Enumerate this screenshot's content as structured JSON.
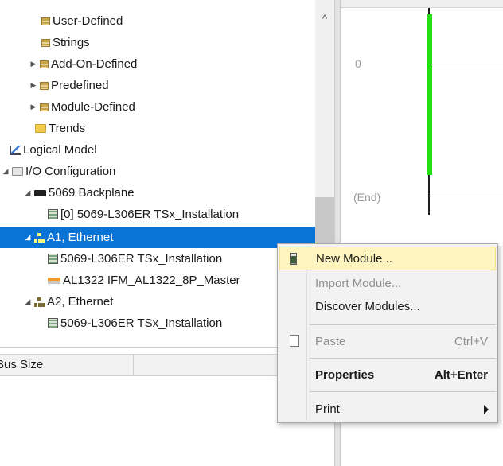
{
  "tree": {
    "items": [
      {
        "label": "User-Defined"
      },
      {
        "label": "Strings"
      },
      {
        "label": "Add-On-Defined"
      },
      {
        "label": "Predefined"
      },
      {
        "label": "Module-Defined"
      },
      {
        "label": "Trends"
      },
      {
        "label": "Logical Model"
      },
      {
        "label": "I/O Configuration"
      },
      {
        "label": "5069 Backplane"
      },
      {
        "label": "[0] 5069-L306ER TSx_Installation"
      },
      {
        "label": "A1, Ethernet"
      },
      {
        "label": "5069-L306ER TSx_Installation"
      },
      {
        "label": "AL1322 IFM_AL1322_8P_Master"
      },
      {
        "label": "A2, Ethernet"
      },
      {
        "label": "5069-L306ER TSx_Installation"
      }
    ],
    "expander_collapsed": "▶",
    "expander_expanded": "◢",
    "scroll_up": "^"
  },
  "properties": {
    "column_1_header": "Bus Size"
  },
  "ladder": {
    "rung_number": "0",
    "end_label": "(End)",
    "power_rail_color": "#22e012"
  },
  "context_menu": {
    "items": [
      {
        "label": "New Module...",
        "icon": "new-module-icon"
      },
      {
        "label": "Import Module..."
      },
      {
        "label": "Discover Modules..."
      },
      {
        "label": "Paste",
        "shortcut": "Ctrl+V",
        "icon": "paste-icon"
      },
      {
        "label": "Properties",
        "shortcut": "Alt+Enter"
      },
      {
        "label": "Print"
      }
    ],
    "highlight_color": "#fdf4bf"
  },
  "colors": {
    "selection": "#0a73d6",
    "menu_background": "#f2f2f2"
  }
}
